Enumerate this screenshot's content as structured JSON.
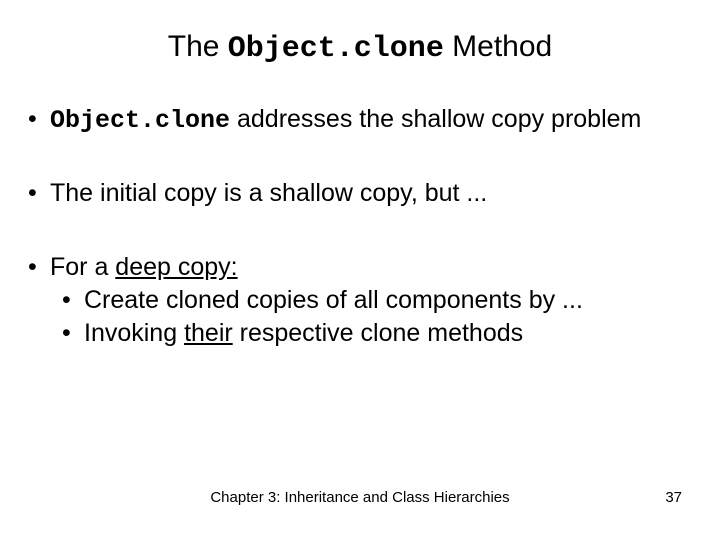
{
  "title": {
    "pre": "The ",
    "code": "Object.clone",
    "post": " Method"
  },
  "bullets": {
    "b1": {
      "code": "Object.clone",
      "post": " addresses the shallow copy problem"
    },
    "b2": "The initial copy is a shallow copy, but ...",
    "b3": {
      "pre": "For a ",
      "u": "deep copy:",
      "sub1": "Create cloned copies of all components by ...",
      "sub2_pre": "Invoking ",
      "sub2_u": "their",
      "sub2_post": " respective clone methods"
    }
  },
  "footer": "Chapter 3: Inheritance and Class Hierarchies",
  "page": "37"
}
